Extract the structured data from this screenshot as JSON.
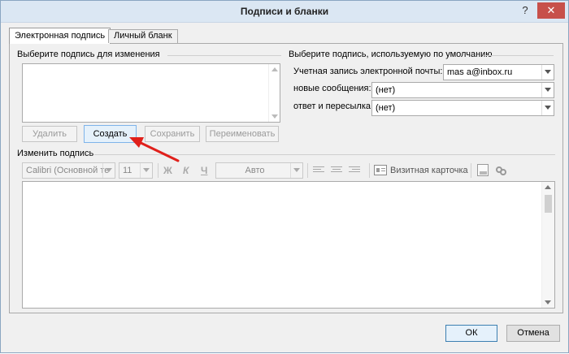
{
  "window": {
    "title": "Подписи и бланки",
    "help": "?",
    "close": "✕"
  },
  "tabs": {
    "email_signature": "Электронная подпись",
    "personal_stationery": "Личный бланк"
  },
  "left_group": {
    "label": "Выберите подпись для изменения"
  },
  "buttons": {
    "delete": "Удалить",
    "create": "Создать",
    "save": "Сохранить",
    "rename": "Переименовать"
  },
  "right_group": {
    "label": "Выберите подпись, используемую по умолчанию",
    "account_label": "Учетная запись электронной почты:",
    "account_value": "mas          a@inbox.ru",
    "new_messages_label": "новые сообщения:",
    "new_messages_value": "(нет)",
    "replies_label": "ответ и пересылка:",
    "replies_value": "(нет)"
  },
  "edit_group": {
    "label": "Изменить подпись"
  },
  "toolbar": {
    "font": "Calibri (Основной те",
    "size": "11",
    "bold": "Ж",
    "italic": "К",
    "underline": "Ч",
    "color": "Авто",
    "business_card": "Визитная карточка"
  },
  "footer": {
    "ok": "ОК",
    "cancel": "Отмена"
  },
  "colors": {
    "annotation_arrow": "#e0201b",
    "titlebar": "#dbe7f3",
    "close_button": "#c7504a"
  }
}
